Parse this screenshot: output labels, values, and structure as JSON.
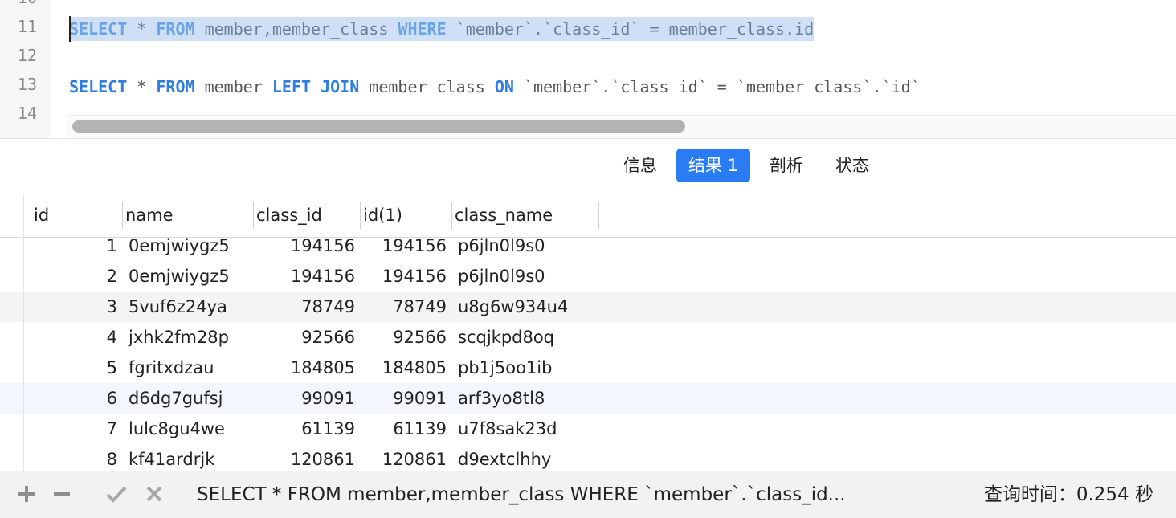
{
  "editor": {
    "lines": [
      {
        "no": "10",
        "parts": []
      },
      {
        "no": "11",
        "selected": true,
        "parts": [
          {
            "t": "SELECT",
            "kw": true
          },
          {
            "t": " * "
          },
          {
            "t": "FROM",
            "kw": true
          },
          {
            "t": " member,member_class "
          },
          {
            "t": "WHERE",
            "kw": true
          },
          {
            "t": " `member`.`class_id` = member_class.id"
          }
        ]
      },
      {
        "no": "12",
        "parts": []
      },
      {
        "no": "13",
        "parts": [
          {
            "t": "SELECT",
            "kw": true
          },
          {
            "t": " * "
          },
          {
            "t": "FROM",
            "kw": true
          },
          {
            "t": " member "
          },
          {
            "t": "LEFT JOIN",
            "kw": true
          },
          {
            "t": " member_class "
          },
          {
            "t": "ON",
            "kw": true
          },
          {
            "t": " `member`.`class_id` = `member_class`.`id`"
          }
        ]
      },
      {
        "no": "14",
        "parts": []
      }
    ]
  },
  "tabs": {
    "info": "信息",
    "result": "结果 1",
    "profile": "剖析",
    "status": "状态"
  },
  "grid": {
    "columns": [
      "id",
      "name",
      "class_id",
      "id(1)",
      "class_name"
    ],
    "rows": [
      {
        "id": "1",
        "name": "0emjwiygz5",
        "class_id": "194156",
        "id1": "194156",
        "class_name": "p6jln0l9s0"
      },
      {
        "id": "2",
        "name": "0emjwiygz5",
        "class_id": "194156",
        "id1": "194156",
        "class_name": "p6jln0l9s0"
      },
      {
        "id": "3",
        "name": "5vuf6z24ya",
        "class_id": "78749",
        "id1": "78749",
        "class_name": "u8g6w934u4"
      },
      {
        "id": "4",
        "name": "jxhk2fm28p",
        "class_id": "92566",
        "id1": "92566",
        "class_name": "scqjkpd8oq"
      },
      {
        "id": "5",
        "name": "fgritxdzau",
        "class_id": "184805",
        "id1": "184805",
        "class_name": "pb1j5oo1ib"
      },
      {
        "id": "6",
        "name": "d6dg7gufsj",
        "class_id": "99091",
        "id1": "99091",
        "class_name": "arf3yo8tl8"
      },
      {
        "id": "7",
        "name": "lulc8gu4we",
        "class_id": "61139",
        "id1": "61139",
        "class_name": "u7f8sak23d"
      },
      {
        "id": "8",
        "name": "kf41ardrjk",
        "class_id": "120861",
        "id1": "120861",
        "class_name": "d9extclhhy"
      }
    ]
  },
  "bottom": {
    "icons": [
      "plus-icon",
      "minus-icon",
      "check-icon",
      "close-icon"
    ],
    "status_sql": "SELECT * FROM member,member_class WHERE `member`.`class_id...",
    "query_time": "查询时间：0.254 秒"
  }
}
